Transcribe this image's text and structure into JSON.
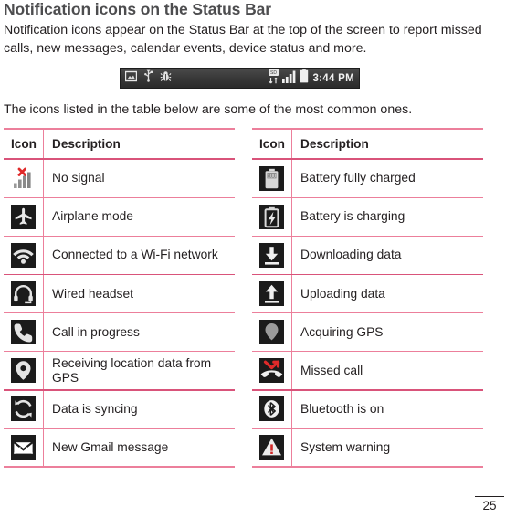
{
  "heading": "Notification icons on the Status Bar",
  "intro": "Notification icons appear on the Status Bar at the top of the screen to report missed calls, new messages, calendar events, device status and more.",
  "sub_note": "The icons listed in the table below are some of the most common ones.",
  "status_bar": {
    "left_icons": [
      "screenshot-icon",
      "usb-icon",
      "bug-icon"
    ],
    "right_icons": [
      "sd-card-data-icon",
      "signal-bars-icon",
      "battery-icon"
    ],
    "time": "3:44 PM",
    "background_color": "#3a3a3a",
    "text_color": "#f2f2f2"
  },
  "colors": {
    "rule_light": "#ec7f9b",
    "rule_dark": "#d9537a",
    "heading": "#4d4d4f",
    "body": "#231f20",
    "icon_tile_dark": "#1b1b1b"
  },
  "tables": [
    {
      "id": "left",
      "headers": {
        "icon": "Icon",
        "description": "Description"
      },
      "rows": [
        {
          "icon": "no-signal-icon",
          "description": "No signal"
        },
        {
          "icon": "airplane-mode-icon",
          "description": "Airplane mode"
        },
        {
          "icon": "wifi-connected-icon",
          "description": "Connected to a Wi-Fi network"
        },
        {
          "icon": "wired-headset-icon",
          "description": "Wired headset"
        },
        {
          "icon": "call-in-progress-icon",
          "description": "Call in progress"
        },
        {
          "icon": "gps-fixed-icon",
          "description": "Receiving location data from GPS"
        },
        {
          "icon": "sync-icon",
          "description": "Data is syncing"
        },
        {
          "icon": "gmail-icon",
          "description": "New Gmail message"
        }
      ]
    },
    {
      "id": "right",
      "headers": {
        "icon": "Icon",
        "description": "Description"
      },
      "rows": [
        {
          "icon": "battery-full-icon",
          "description": "Battery fully charged"
        },
        {
          "icon": "battery-charging-icon",
          "description": "Battery is charging"
        },
        {
          "icon": "download-icon",
          "description": "Downloading data"
        },
        {
          "icon": "upload-icon",
          "description": "Uploading data"
        },
        {
          "icon": "gps-acquiring-icon",
          "description": "Acquiring GPS"
        },
        {
          "icon": "missed-call-icon",
          "description": "Missed call"
        },
        {
          "icon": "bluetooth-icon",
          "description": "Bluetooth is on"
        },
        {
          "icon": "system-warning-icon",
          "description": "System warning"
        }
      ]
    }
  ],
  "footer": {
    "page_number": "25"
  }
}
